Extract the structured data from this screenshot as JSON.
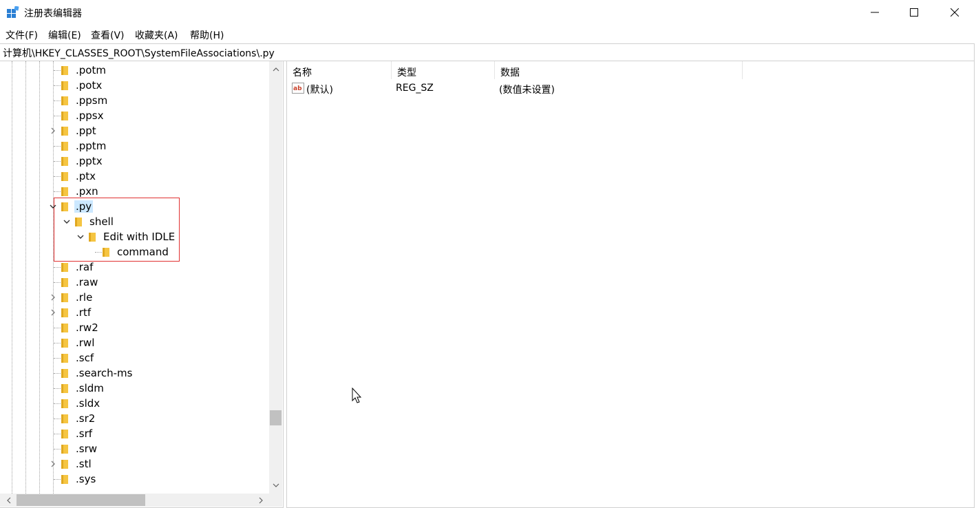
{
  "window": {
    "title": "注册表编辑器",
    "icon": "registry-editor-icon",
    "controls": {
      "minimize": "minimize-icon",
      "maximize": "maximize-icon",
      "close": "close-icon"
    }
  },
  "menu": [
    "文件(F)",
    "编辑(E)",
    "查看(V)",
    "收藏夹(A)",
    "帮助(H)"
  ],
  "address": "计算机\\HKEY_CLASSES_ROOT\\SystemFileAssociations\\.py",
  "tree": [
    {
      "label": ".potm",
      "depth": 0,
      "expander": "none"
    },
    {
      "label": ".potx",
      "depth": 0,
      "expander": "none"
    },
    {
      "label": ".ppsm",
      "depth": 0,
      "expander": "none"
    },
    {
      "label": ".ppsx",
      "depth": 0,
      "expander": "none"
    },
    {
      "label": ".ppt",
      "depth": 0,
      "expander": "collapsed"
    },
    {
      "label": ".pptm",
      "depth": 0,
      "expander": "none"
    },
    {
      "label": ".pptx",
      "depth": 0,
      "expander": "none"
    },
    {
      "label": ".ptx",
      "depth": 0,
      "expander": "none"
    },
    {
      "label": ".pxn",
      "depth": 0,
      "expander": "none"
    },
    {
      "label": ".py",
      "depth": 0,
      "expander": "expanded",
      "selected": true
    },
    {
      "label": "shell",
      "depth": 1,
      "expander": "expanded"
    },
    {
      "label": "Edit with IDLE",
      "depth": 2,
      "expander": "expanded"
    },
    {
      "label": "command",
      "depth": 3,
      "expander": "none"
    },
    {
      "label": ".raf",
      "depth": 0,
      "expander": "none"
    },
    {
      "label": ".raw",
      "depth": 0,
      "expander": "none"
    },
    {
      "label": ".rle",
      "depth": 0,
      "expander": "collapsed"
    },
    {
      "label": ".rtf",
      "depth": 0,
      "expander": "collapsed"
    },
    {
      "label": ".rw2",
      "depth": 0,
      "expander": "none"
    },
    {
      "label": ".rwl",
      "depth": 0,
      "expander": "none"
    },
    {
      "label": ".scf",
      "depth": 0,
      "expander": "none"
    },
    {
      "label": ".search-ms",
      "depth": 0,
      "expander": "none"
    },
    {
      "label": ".sldm",
      "depth": 0,
      "expander": "none"
    },
    {
      "label": ".sldx",
      "depth": 0,
      "expander": "none"
    },
    {
      "label": ".sr2",
      "depth": 0,
      "expander": "none"
    },
    {
      "label": ".srf",
      "depth": 0,
      "expander": "none"
    },
    {
      "label": ".srw",
      "depth": 0,
      "expander": "none"
    },
    {
      "label": ".stl",
      "depth": 0,
      "expander": "collapsed"
    },
    {
      "label": ".sys",
      "depth": 0,
      "expander": "none"
    }
  ],
  "values": {
    "columns": [
      "名称",
      "类型",
      "数据"
    ],
    "rows": [
      {
        "icon": "string-value-icon",
        "name": "(默认)",
        "type": "REG_SZ",
        "data": "(数值未设置)"
      }
    ]
  },
  "colors": {
    "selection": "#cce8ff",
    "highlight_box": "#e03030",
    "folder": "#f5c542"
  }
}
